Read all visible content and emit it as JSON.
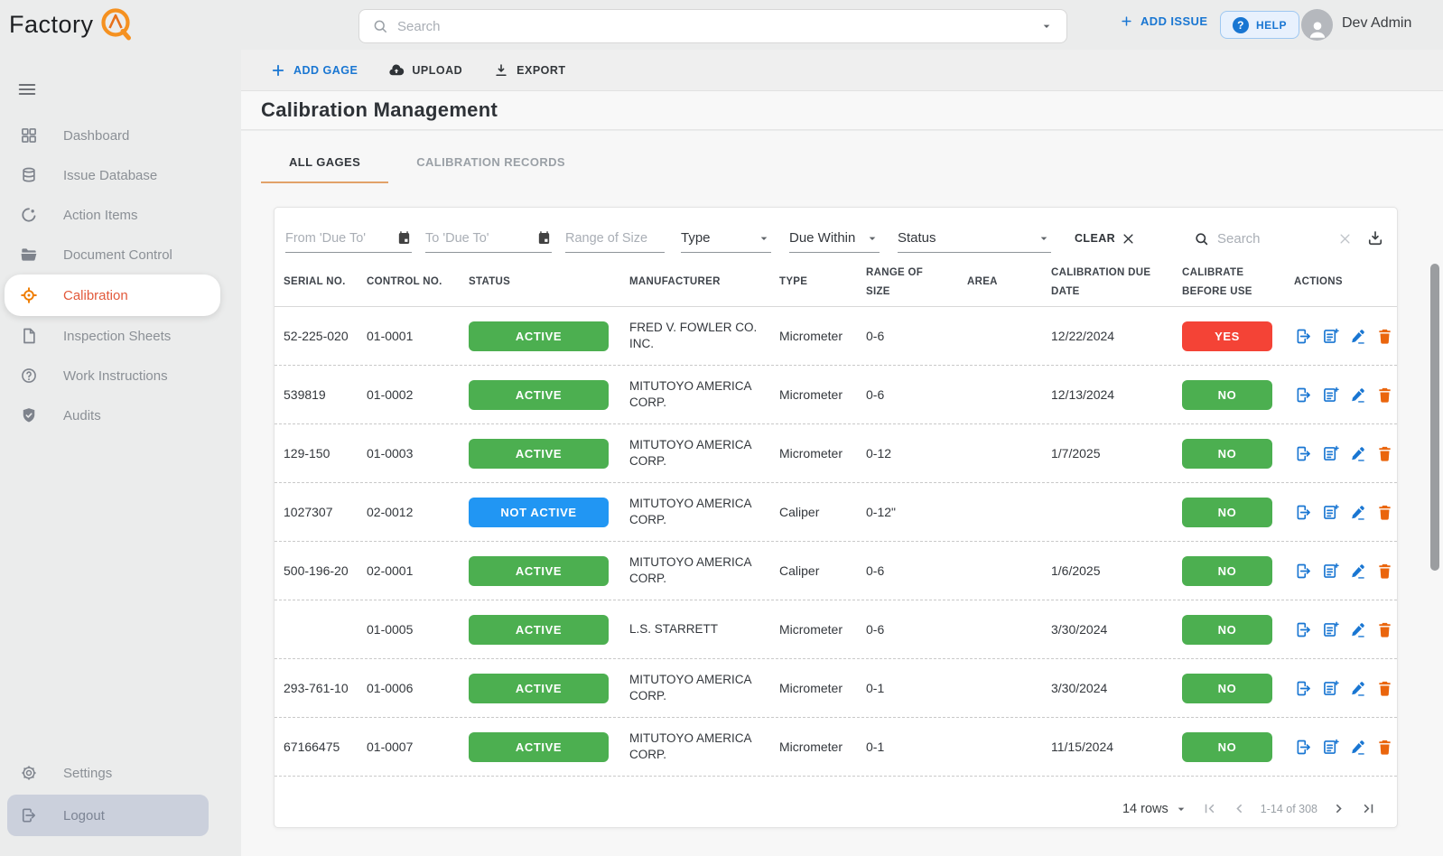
{
  "topbar": {
    "logo_text": "Factory",
    "search_placeholder": "Search",
    "add_issue_label": "ADD ISSUE",
    "help_label": "HELP",
    "user_name": "Dev Admin"
  },
  "sidebar": {
    "items": [
      {
        "label": "Dashboard",
        "icon": "dashboard-icon",
        "active": false
      },
      {
        "label": "Issue Database",
        "icon": "database-icon",
        "active": false
      },
      {
        "label": "Action Items",
        "icon": "pie-icon",
        "active": false
      },
      {
        "label": "Document Control",
        "icon": "folder-icon",
        "active": false
      },
      {
        "label": "Calibration",
        "icon": "target-icon",
        "active": true
      },
      {
        "label": "Inspection Sheets",
        "icon": "document-icon",
        "active": false
      },
      {
        "label": "Work Instructions",
        "icon": "question-circle-icon",
        "active": false
      },
      {
        "label": "Audits",
        "icon": "shield-check-icon",
        "active": false
      }
    ],
    "settings_label": "Settings",
    "logout_label": "Logout"
  },
  "toolbar": {
    "add_gage_label": "ADD GAGE",
    "upload_label": "UPLOAD",
    "export_label": "EXPORT"
  },
  "page": {
    "title": "Calibration Management"
  },
  "tabs": [
    {
      "label": "ALL GAGES",
      "active": true
    },
    {
      "label": "CALIBRATION RECORDS",
      "active": false
    }
  ],
  "filters": {
    "from_due_to_placeholder": "From 'Due To'",
    "to_due_to_placeholder": "To 'Due To'",
    "range_of_size_placeholder": "Range of Size",
    "type_label": "Type",
    "due_within_label": "Due Within",
    "status_label": "Status",
    "clear_label": "CLEAR",
    "search_placeholder": "Search"
  },
  "table": {
    "columns": [
      "SERIAL NO.",
      "CONTROL NO.",
      "STATUS",
      "MANUFACTURER",
      "TYPE",
      "RANGE OF SIZE",
      "AREA",
      "CALIBRATION DUE DATE",
      "CALIBRATE BEFORE USE",
      "ACTIONS"
    ],
    "rows": [
      {
        "serial_no": "52-225-020",
        "control_no": "01-0001",
        "status": "ACTIVE",
        "manufacturer": "FRED V. FOWLER CO. INC.",
        "type": "Micrometer",
        "range_of_size": "0-6",
        "area": "",
        "calibration_due_date": "12/22/2024",
        "calibrate_before_use": "YES"
      },
      {
        "serial_no": "539819",
        "control_no": "01-0002",
        "status": "ACTIVE",
        "manufacturer": "MITUTOYO AMERICA CORP.",
        "type": "Micrometer",
        "range_of_size": "0-6",
        "area": "",
        "calibration_due_date": "12/13/2024",
        "calibrate_before_use": "NO"
      },
      {
        "serial_no": "129-150",
        "control_no": "01-0003",
        "status": "ACTIVE",
        "manufacturer": "MITUTOYO AMERICA CORP.",
        "type": "Micrometer",
        "range_of_size": "0-12",
        "area": "",
        "calibration_due_date": "1/7/2025",
        "calibrate_before_use": "NO"
      },
      {
        "serial_no": "1027307",
        "control_no": "02-0012",
        "status": "NOT ACTIVE",
        "manufacturer": "MITUTOYO AMERICA CORP.",
        "type": "Caliper",
        "range_of_size": "0-12\"",
        "area": "",
        "calibration_due_date": "",
        "calibrate_before_use": "NO"
      },
      {
        "serial_no": "500-196-20",
        "control_no": "02-0001",
        "status": "ACTIVE",
        "manufacturer": "MITUTOYO AMERICA CORP.",
        "type": "Caliper",
        "range_of_size": "0-6",
        "area": "",
        "calibration_due_date": "1/6/2025",
        "calibrate_before_use": "NO"
      },
      {
        "serial_no": "",
        "control_no": "01-0005",
        "status": "ACTIVE",
        "manufacturer": "L.S. STARRETT",
        "type": "Micrometer",
        "range_of_size": "0-6",
        "area": "",
        "calibration_due_date": "3/30/2024",
        "calibrate_before_use": "NO"
      },
      {
        "serial_no": "293-761-10",
        "control_no": "01-0006",
        "status": "ACTIVE",
        "manufacturer": "MITUTOYO AMERICA CORP.",
        "type": "Micrometer",
        "range_of_size": "0-1",
        "area": "",
        "calibration_due_date": "3/30/2024",
        "calibrate_before_use": "NO"
      },
      {
        "serial_no": "67166475",
        "control_no": "01-0007",
        "status": "ACTIVE",
        "manufacturer": "MITUTOYO AMERICA CORP.",
        "type": "Micrometer",
        "range_of_size": "0-1",
        "area": "",
        "calibration_due_date": "11/15/2024",
        "calibrate_before_use": "NO"
      }
    ],
    "row_actions": [
      {
        "name": "open-record-button",
        "icon": "open-record-icon"
      },
      {
        "name": "add-record-button",
        "icon": "note-add-icon"
      },
      {
        "name": "edit-record-button",
        "icon": "edit-icon"
      },
      {
        "name": "delete-record-button",
        "icon": "trash-icon"
      }
    ]
  },
  "pagination": {
    "rows_per_page_label": "14 rows",
    "range_label": "1-14 of 308"
  },
  "colors": {
    "status_active": "#4caf50",
    "status_not_active": "#2196f3",
    "cbu_yes": "#f44336",
    "cbu_no": "#4caf50",
    "accent_blue": "#1976d2",
    "accent_orange": "#ef7d00",
    "trash_orange": "#ea650d",
    "tab_underline": "#e2a269"
  }
}
